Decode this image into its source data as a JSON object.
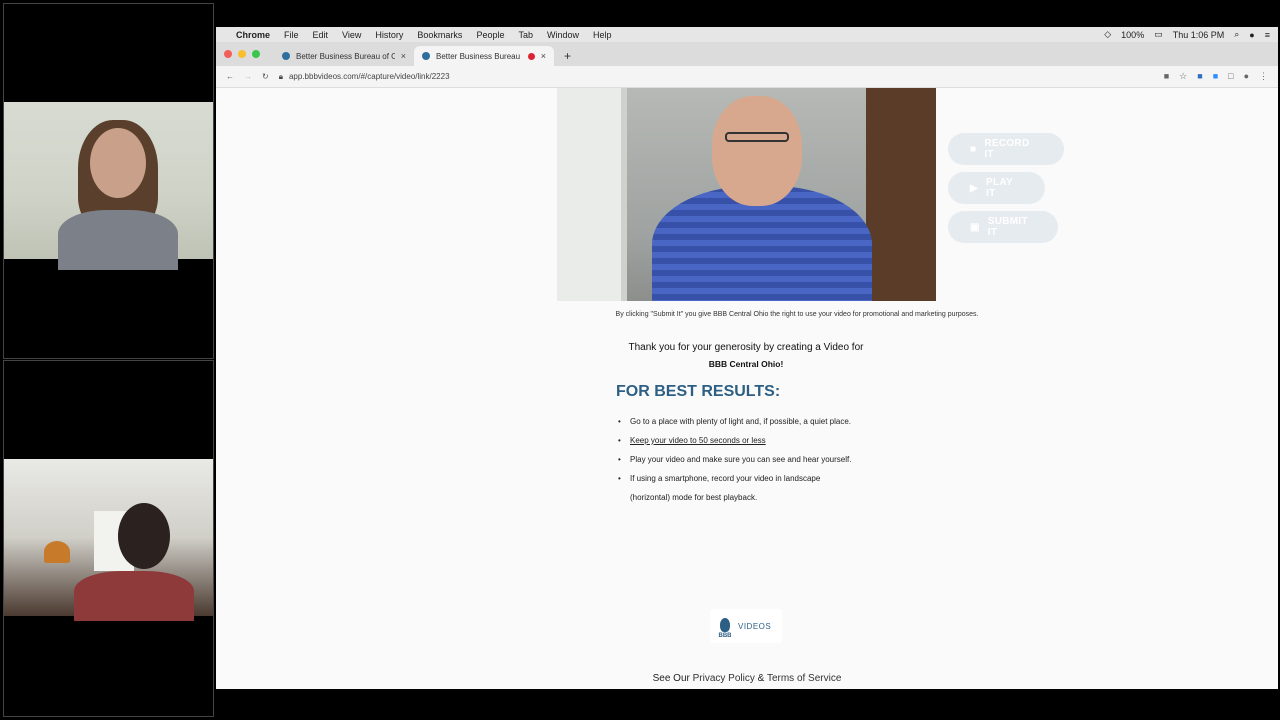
{
  "menubar": {
    "app": "Chrome",
    "menus": [
      "File",
      "Edit",
      "View",
      "History",
      "Bookmarks",
      "People",
      "Tab",
      "Window",
      "Help"
    ],
    "battery": "100%",
    "time": "Thu 1:06 PM"
  },
  "tabs": [
    {
      "title": "Better Business Bureau of Cen"
    },
    {
      "title": "Better Business Bureau of"
    }
  ],
  "address": {
    "url": "app.bbbvideos.com/#/capture/video/link/2223"
  },
  "controls": {
    "record": "RECORD IT",
    "play": "PLAY IT",
    "submit": "SUBMIT IT"
  },
  "disclaimer": "By clicking \"Submit It\" you give BBB Central Ohio the right to use your video for promotional and marketing purposes.",
  "thanks": {
    "line": "Thank you for your generosity by creating a Video for",
    "org": "BBB Central Ohio!"
  },
  "best_results": {
    "heading": "FOR BEST RESULTS:",
    "tips": [
      "Go to a place with plenty of light and, if possible, a quiet place.",
      "Keep your video to 50 seconds or less",
      "Play your video and make sure you can see and hear yourself.",
      "If using a smartphone, record your video in landscape",
      "(horizontal) mode for best playback."
    ]
  },
  "logo": {
    "bbb": "BBB",
    "videos": "VIDEOS"
  },
  "footer": {
    "prefix": "See Our",
    "privacy": "Privacy Policy",
    "amp": "&",
    "terms": "Terms of Service"
  },
  "colors": {
    "accent": "#2d5f84",
    "button_bg": "#e6ebef"
  }
}
